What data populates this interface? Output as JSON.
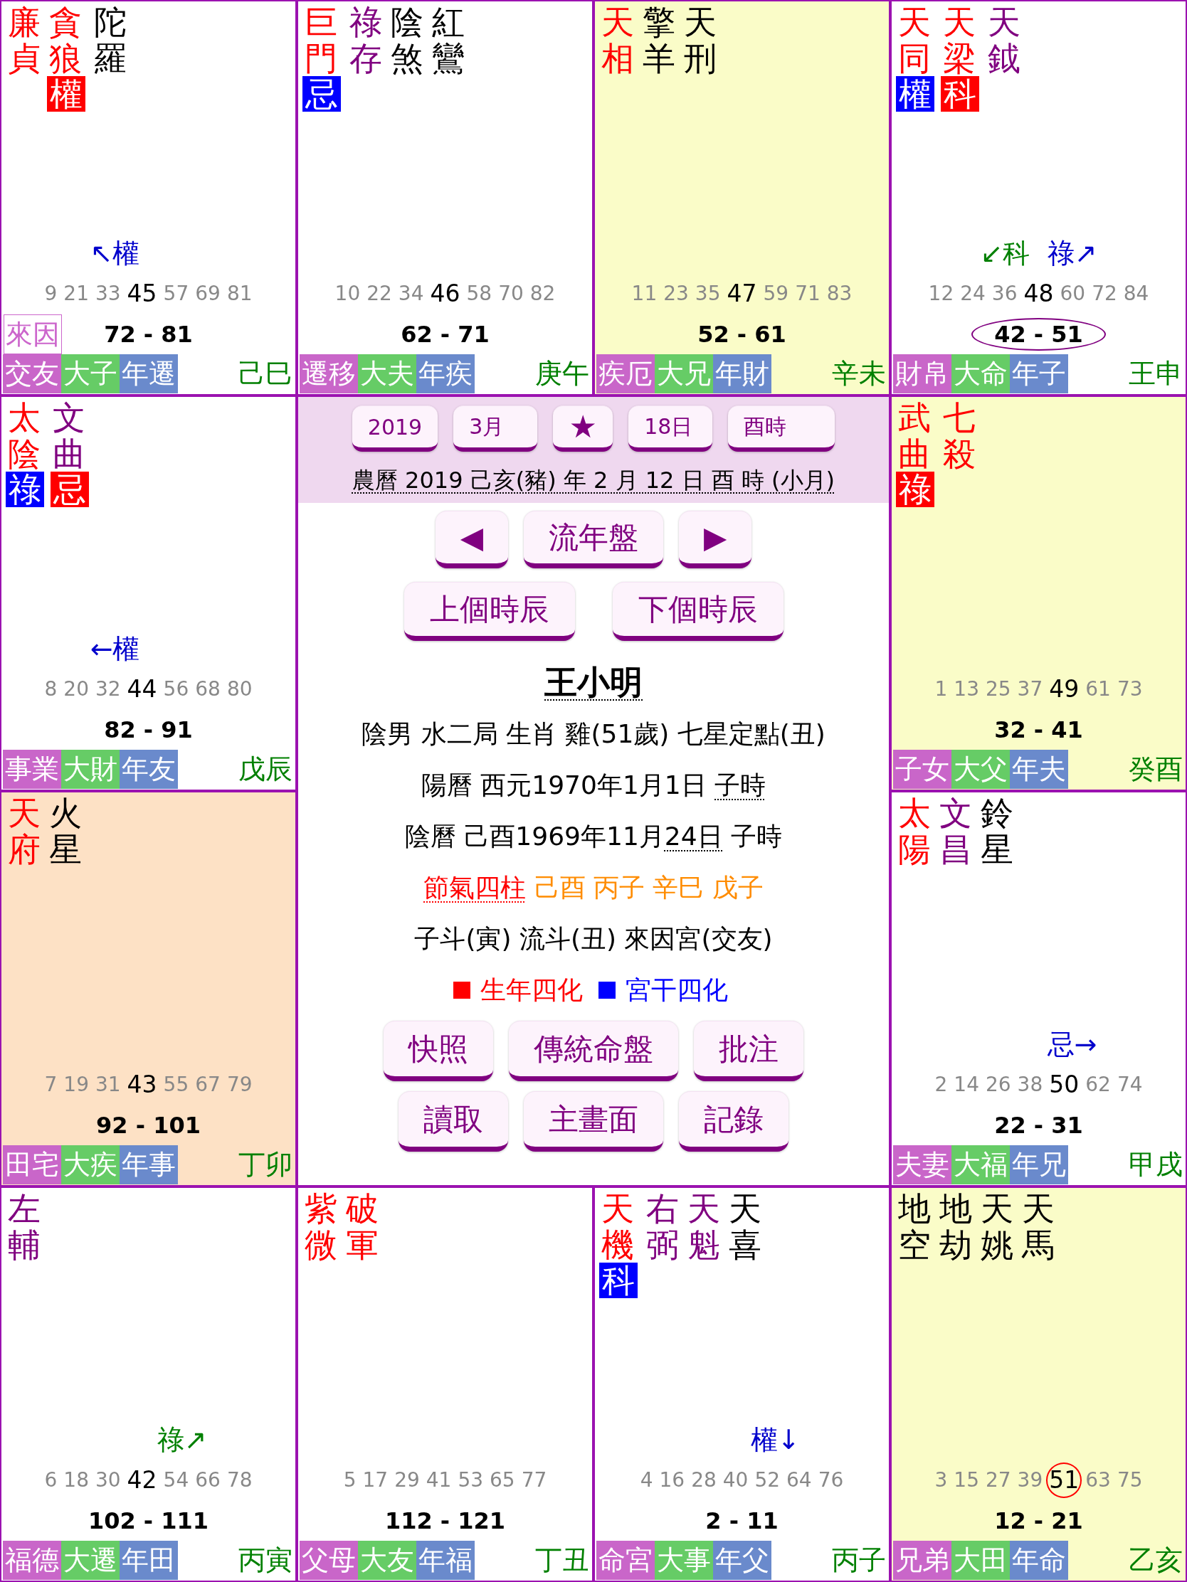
{
  "palaces": [
    {
      "color": "#ffffff",
      "stars": [
        {
          "name": "廉貞",
          "color": "#ff0000"
        },
        {
          "name": "貪狼",
          "color": "#ff0000",
          "transforms": [
            {
              "text": "權",
              "color": "#ff0000"
            }
          ]
        },
        {
          "name": "陀羅",
          "color": "#000000"
        }
      ],
      "flying": [
        {
          "text": "↖權",
          "color": "#0000cc",
          "kind": "left"
        }
      ],
      "ages": [
        {
          "text": "9",
          "selected": false,
          "circled": false
        },
        {
          "text": "21",
          "selected": false,
          "circled": false
        },
        {
          "text": "33",
          "selected": false,
          "circled": false
        },
        {
          "text": "45",
          "selected": true,
          "circled": false
        },
        {
          "text": "57",
          "selected": false,
          "circled": false
        },
        {
          "text": "69",
          "selected": false,
          "circled": false
        },
        {
          "text": "81",
          "selected": false,
          "circled": false
        }
      ],
      "decade": {
        "text": "72 - 81",
        "selected": false
      },
      "origin_tag": "來因",
      "tags": {
        "palace": "交友",
        "decade": "大子",
        "year": "年遷"
      },
      "stem_branch": "己巳"
    },
    {
      "color": "#ffffff",
      "stars": [
        {
          "name": "巨門",
          "color": "#ff0000",
          "transforms": [
            {
              "text": "忌",
              "color": "#0000ff"
            }
          ]
        },
        {
          "name": "祿存",
          "color": "#800080"
        },
        {
          "name": "陰煞",
          "color": "#000000"
        },
        {
          "name": "紅鸞",
          "color": "#000000"
        }
      ],
      "ages": [
        {
          "text": "10",
          "selected": false,
          "circled": false
        },
        {
          "text": "22",
          "selected": false,
          "circled": false
        },
        {
          "text": "34",
          "selected": false,
          "circled": false
        },
        {
          "text": "46",
          "selected": true,
          "circled": false
        },
        {
          "text": "58",
          "selected": false,
          "circled": false
        },
        {
          "text": "70",
          "selected": false,
          "circled": false
        },
        {
          "text": "82",
          "selected": false,
          "circled": false
        }
      ],
      "decade": {
        "text": "62 - 71",
        "selected": false
      },
      "tags": {
        "palace": "遷移",
        "decade": "大夫",
        "year": "年疾"
      },
      "stem_branch": "庚午"
    },
    {
      "color": "#fafcc8",
      "stars": [
        {
          "name": "天相",
          "color": "#ff0000"
        },
        {
          "name": "擎羊",
          "color": "#000000"
        },
        {
          "name": "天刑",
          "color": "#000000"
        }
      ],
      "ages": [
        {
          "text": "11",
          "selected": false,
          "circled": false
        },
        {
          "text": "23",
          "selected": false,
          "circled": false
        },
        {
          "text": "35",
          "selected": false,
          "circled": false
        },
        {
          "text": "47",
          "selected": true,
          "circled": false
        },
        {
          "text": "59",
          "selected": false,
          "circled": false
        },
        {
          "text": "71",
          "selected": false,
          "circled": false
        },
        {
          "text": "83",
          "selected": false,
          "circled": false
        }
      ],
      "decade": {
        "text": "52 - 61",
        "selected": false
      },
      "tags": {
        "palace": "疾厄",
        "decade": "大兄",
        "year": "年財"
      },
      "stem_branch": "辛未"
    },
    {
      "color": "#ffffff",
      "stars": [
        {
          "name": "天同",
          "color": "#ff0000",
          "transforms": [
            {
              "text": "權",
              "color": "#0000ff"
            }
          ]
        },
        {
          "name": "天梁",
          "color": "#ff0000",
          "transforms": [
            {
              "text": "科",
              "color": "#ff0000"
            }
          ]
        },
        {
          "name": "天鉞",
          "color": "#800080"
        }
      ],
      "flying": [
        {
          "text": "↙科",
          "color": "#008000",
          "kind": "left"
        },
        {
          "text": "祿↗",
          "color": "#0000cc",
          "kind": "right"
        }
      ],
      "ages": [
        {
          "text": "12",
          "selected": false,
          "circled": false
        },
        {
          "text": "24",
          "selected": false,
          "circled": false
        },
        {
          "text": "36",
          "selected": false,
          "circled": false
        },
        {
          "text": "48",
          "selected": true,
          "circled": false
        },
        {
          "text": "60",
          "selected": false,
          "circled": false
        },
        {
          "text": "72",
          "selected": false,
          "circled": false
        },
        {
          "text": "84",
          "selected": false,
          "circled": false
        }
      ],
      "decade": {
        "text": "42 - 51",
        "selected": true
      },
      "tags": {
        "palace": "財帛",
        "decade": "大命",
        "year": "年子"
      },
      "stem_branch": "王申"
    },
    {
      "color": "#ffffff",
      "stars": [
        {
          "name": "太陰",
          "color": "#ff0000",
          "transforms": [
            {
              "text": "祿",
              "color": "#0000ff"
            }
          ]
        },
        {
          "name": "文曲",
          "color": "#800080",
          "transforms": [
            {
              "text": "忌",
              "color": "#ff0000"
            }
          ]
        }
      ],
      "flying": [
        {
          "text": "←權",
          "color": "#0000cc",
          "kind": "left"
        }
      ],
      "ages": [
        {
          "text": "8",
          "selected": false,
          "circled": false
        },
        {
          "text": "20",
          "selected": false,
          "circled": false
        },
        {
          "text": "32",
          "selected": false,
          "circled": false
        },
        {
          "text": "44",
          "selected": true,
          "circled": false
        },
        {
          "text": "56",
          "selected": false,
          "circled": false
        },
        {
          "text": "68",
          "selected": false,
          "circled": false
        },
        {
          "text": "80",
          "selected": false,
          "circled": false
        }
      ],
      "decade": {
        "text": "82 - 91",
        "selected": false
      },
      "tags": {
        "palace": "事業",
        "decade": "大財",
        "year": "年友"
      },
      "stem_branch": "戊辰"
    },
    {
      "color": "#fafcc8",
      "stars": [
        {
          "name": "武曲",
          "color": "#ff0000",
          "transforms": [
            {
              "text": "祿",
              "color": "#ff0000"
            }
          ]
        },
        {
          "name": "七殺",
          "color": "#ff0000"
        }
      ],
      "ages": [
        {
          "text": "1",
          "selected": false,
          "circled": false
        },
        {
          "text": "13",
          "selected": false,
          "circled": false
        },
        {
          "text": "25",
          "selected": false,
          "circled": false
        },
        {
          "text": "37",
          "selected": false,
          "circled": false
        },
        {
          "text": "49",
          "selected": true,
          "circled": false
        },
        {
          "text": "61",
          "selected": false,
          "circled": false
        },
        {
          "text": "73",
          "selected": false,
          "circled": false
        }
      ],
      "decade": {
        "text": "32 - 41",
        "selected": false
      },
      "tags": {
        "palace": "子女",
        "decade": "大父",
        "year": "年夫"
      },
      "stem_branch": "癸酉"
    },
    {
      "color": "#fde1c5",
      "stars": [
        {
          "name": "天府",
          "color": "#ff0000"
        },
        {
          "name": "火星",
          "color": "#000000"
        }
      ],
      "ages": [
        {
          "text": "7",
          "selected": false,
          "circled": false
        },
        {
          "text": "19",
          "selected": false,
          "circled": false
        },
        {
          "text": "31",
          "selected": false,
          "circled": false
        },
        {
          "text": "43",
          "selected": true,
          "circled": false
        },
        {
          "text": "55",
          "selected": false,
          "circled": false
        },
        {
          "text": "67",
          "selected": false,
          "circled": false
        },
        {
          "text": "79",
          "selected": false,
          "circled": false
        }
      ],
      "decade": {
        "text": "92 - 101",
        "selected": false
      },
      "tags": {
        "palace": "田宅",
        "decade": "大疾",
        "year": "年事"
      },
      "stem_branch": "丁卯"
    },
    {
      "color": "#ffffff",
      "stars": [
        {
          "name": "太陽",
          "color": "#ff0000"
        },
        {
          "name": "文昌",
          "color": "#800080"
        },
        {
          "name": "鈴星",
          "color": "#000000"
        }
      ],
      "flying": [
        {
          "text": "忌→",
          "color": "#0000cc",
          "kind": "right"
        }
      ],
      "ages": [
        {
          "text": "2",
          "selected": false,
          "circled": false
        },
        {
          "text": "14",
          "selected": false,
          "circled": false
        },
        {
          "text": "26",
          "selected": false,
          "circled": false
        },
        {
          "text": "38",
          "selected": false,
          "circled": false
        },
        {
          "text": "50",
          "selected": true,
          "circled": false
        },
        {
          "text": "62",
          "selected": false,
          "circled": false
        },
        {
          "text": "74",
          "selected": false,
          "circled": false
        }
      ],
      "decade": {
        "text": "22 - 31",
        "selected": false
      },
      "tags": {
        "palace": "夫妻",
        "decade": "大福",
        "year": "年兄"
      },
      "stem_branch": "甲戌"
    },
    {
      "color": "#ffffff",
      "stars": [
        {
          "name": "左輔",
          "color": "#800080"
        }
      ],
      "flying": [
        {
          "text": "祿↗",
          "color": "#008000",
          "kind": "right"
        }
      ],
      "ages": [
        {
          "text": "6",
          "selected": false,
          "circled": false
        },
        {
          "text": "18",
          "selected": false,
          "circled": false
        },
        {
          "text": "30",
          "selected": false,
          "circled": false
        },
        {
          "text": "42",
          "selected": true,
          "circled": false
        },
        {
          "text": "54",
          "selected": false,
          "circled": false
        },
        {
          "text": "66",
          "selected": false,
          "circled": false
        },
        {
          "text": "78",
          "selected": false,
          "circled": false
        }
      ],
      "decade": {
        "text": "102 - 111",
        "selected": false
      },
      "tags": {
        "palace": "福德",
        "decade": "大遷",
        "year": "年田"
      },
      "stem_branch": "丙寅"
    },
    {
      "color": "#ffffff",
      "stars": [
        {
          "name": "紫微",
          "color": "#ff0000"
        },
        {
          "name": "破軍",
          "color": "#ff0000"
        }
      ],
      "ages": [
        {
          "text": "5",
          "selected": false,
          "circled": false
        },
        {
          "text": "17",
          "selected": false,
          "circled": false
        },
        {
          "text": "29",
          "selected": false,
          "circled": false
        },
        {
          "text": "41",
          "selected": false,
          "circled": false
        },
        {
          "text": "53",
          "selected": false,
          "circled": false
        },
        {
          "text": "65",
          "selected": false,
          "circled": false
        },
        {
          "text": "77",
          "selected": false,
          "circled": false
        }
      ],
      "decade": {
        "text": "112 - 121",
        "selected": false
      },
      "tags": {
        "palace": "父母",
        "decade": "大友",
        "year": "年福"
      },
      "stem_branch": "丁丑"
    },
    {
      "color": "#ffffff",
      "stars": [
        {
          "name": "天機",
          "color": "#ff0000",
          "transforms": [
            {
              "text": "科",
              "color": "#0000ff"
            }
          ]
        },
        {
          "name": "右弼",
          "color": "#800080"
        },
        {
          "name": "天魁",
          "color": "#800080"
        },
        {
          "name": "天喜",
          "color": "#000000"
        }
      ],
      "flying": [
        {
          "text": "權↓",
          "color": "#0000cc",
          "kind": "right"
        }
      ],
      "ages": [
        {
          "text": "4",
          "selected": false,
          "circled": false
        },
        {
          "text": "16",
          "selected": false,
          "circled": false
        },
        {
          "text": "28",
          "selected": false,
          "circled": false
        },
        {
          "text": "40",
          "selected": false,
          "circled": false
        },
        {
          "text": "52",
          "selected": false,
          "circled": false
        },
        {
          "text": "64",
          "selected": false,
          "circled": false
        },
        {
          "text": "76",
          "selected": false,
          "circled": false
        }
      ],
      "decade": {
        "text": "2 - 11",
        "selected": false
      },
      "tags": {
        "palace": "命宮",
        "decade": "大事",
        "year": "年父"
      },
      "stem_branch": "丙子"
    },
    {
      "color": "#fafcc8",
      "stars": [
        {
          "name": "地空",
          "color": "#000000"
        },
        {
          "name": "地劫",
          "color": "#000000"
        },
        {
          "name": "天姚",
          "color": "#000000"
        },
        {
          "name": "天馬",
          "color": "#000000"
        }
      ],
      "ages": [
        {
          "text": "3",
          "selected": false,
          "circled": false
        },
        {
          "text": "15",
          "selected": false,
          "circled": false
        },
        {
          "text": "27",
          "selected": false,
          "circled": false
        },
        {
          "text": "39",
          "selected": false,
          "circled": false
        },
        {
          "text": "51",
          "selected": true,
          "circled": true
        },
        {
          "text": "63",
          "selected": false,
          "circled": false
        },
        {
          "text": "75",
          "selected": false,
          "circled": false
        }
      ],
      "decade": {
        "text": "12 - 21",
        "selected": false
      },
      "tags": {
        "palace": "兄弟",
        "decade": "大田",
        "year": "年命"
      },
      "stem_branch": "乙亥"
    }
  ],
  "center": {
    "selectors": [
      {
        "kind": "select",
        "text": "2019"
      },
      {
        "kind": "select",
        "text": "3月"
      },
      {
        "kind": "button",
        "text": "★"
      },
      {
        "kind": "select",
        "text": "18日"
      },
      {
        "kind": "select",
        "text": "酉時"
      }
    ],
    "lunar_date": "農曆 2019 己亥(豬) 年 2 月 12 日 酉 時 (小月)",
    "navigation": {
      "previous": "◀",
      "mode": "流年盤",
      "next": "▶"
    },
    "hour_buttons": [
      "上個時辰",
      "下個時辰"
    ],
    "person_name": "王小明",
    "info_lines": [
      [
        {
          "kind": "plain",
          "text": "陰男 水二局 生肖 雞(51歲) 七星定點(丑)"
        }
      ],
      [
        {
          "kind": "plain",
          "text": "陽曆 西元1970年1月1日 "
        },
        {
          "kind": "link",
          "text": "子時"
        }
      ],
      [
        {
          "kind": "plain",
          "text": "陰曆 己酉1969年11月"
        },
        {
          "kind": "link",
          "text": "24日"
        },
        {
          "kind": "plain",
          "text": " 子時"
        }
      ],
      [
        {
          "kind": "term",
          "text": "節氣四柱"
        },
        {
          "kind": "highlight",
          "text": " 己酉 丙子 辛巳 戊子"
        }
      ],
      [
        {
          "kind": "plain",
          "text": "子斗(寅) 流斗(丑) 來因宮(交友)"
        }
      ]
    ],
    "legend": [
      {
        "text": "生年四化",
        "color": "#ff0000"
      },
      {
        "text": "宮干四化",
        "color": "#0000ff"
      }
    ],
    "actions": [
      [
        "快照",
        "傳統命盤",
        "批注"
      ],
      [
        "讀取",
        "主畫面",
        "記錄"
      ]
    ]
  }
}
